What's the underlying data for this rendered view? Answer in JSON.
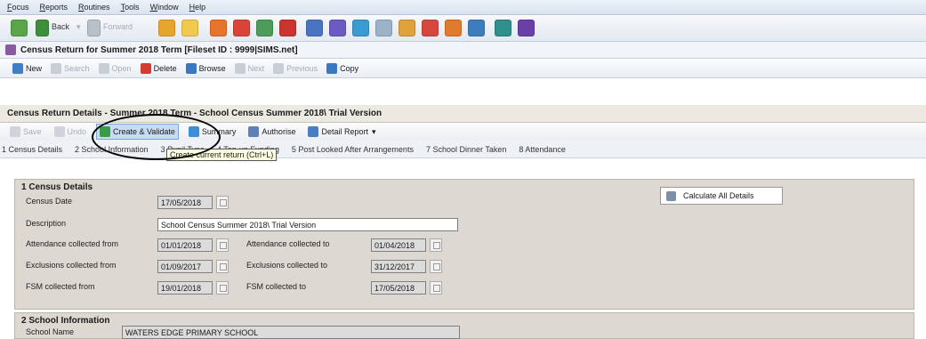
{
  "menu": [
    "Focus",
    "Reports",
    "Routines",
    "Tools",
    "Window",
    "Help"
  ],
  "nav": {
    "back": "Back",
    "forward": "Forward"
  },
  "window_title": "Census Return for Summer 2018 Term [Fileset ID : 9999|SIMS.net]",
  "commands": {
    "new": "New",
    "search": "Search",
    "open": "Open",
    "delete": "Delete",
    "browse": "Browse",
    "next": "Next",
    "previous": "Previous",
    "copy": "Copy"
  },
  "panel_title": "Census Return Details - Summer 2018 Term - School Census Summer 2018\\ Trial Version",
  "actions": {
    "save": "Save",
    "undo": "Undo",
    "create_validate": "Create & Validate",
    "summary": "Summary",
    "authorise": "Authorise",
    "detail_report": "Detail Report"
  },
  "tabs": [
    "1 Census Details",
    "2 School Information",
    "3 Pupil Type",
    "4 Top-up Funding",
    "5 Post Looked After Arrangements",
    "7 School Dinner Taken",
    "8 Attendance"
  ],
  "tooltip": "Create current return (Ctrl+L)",
  "census_details": {
    "title": "1 Census Details",
    "census_date_label": "Census Date",
    "census_date": "17/05/2018",
    "description_label": "Description",
    "description": "School Census Summer 2018\\ Trial Version",
    "attendance_from_label": "Attendance collected from",
    "attendance_from": "01/01/2018",
    "attendance_to_label": "Attendance collected to",
    "attendance_to": "01/04/2018",
    "exclusions_from_label": "Exclusions collected from",
    "exclusions_from": "01/09/2017",
    "exclusions_to_label": "Exclusions collected to",
    "exclusions_to": "31/12/2017",
    "fsm_from_label": "FSM collected from",
    "fsm_from": "19/01/2018",
    "fsm_to_label": "FSM collected to",
    "fsm_to": "17/05/2018",
    "calculate_button": "Calculate All Details"
  },
  "school_information": {
    "title": "2 School Information",
    "school_name_label": "School Name",
    "school_name": "WATERS EDGE PRIMARY SCHOOL"
  },
  "colors": {
    "highlight": "#c6dcf5",
    "panel": "#ddd9d2"
  }
}
